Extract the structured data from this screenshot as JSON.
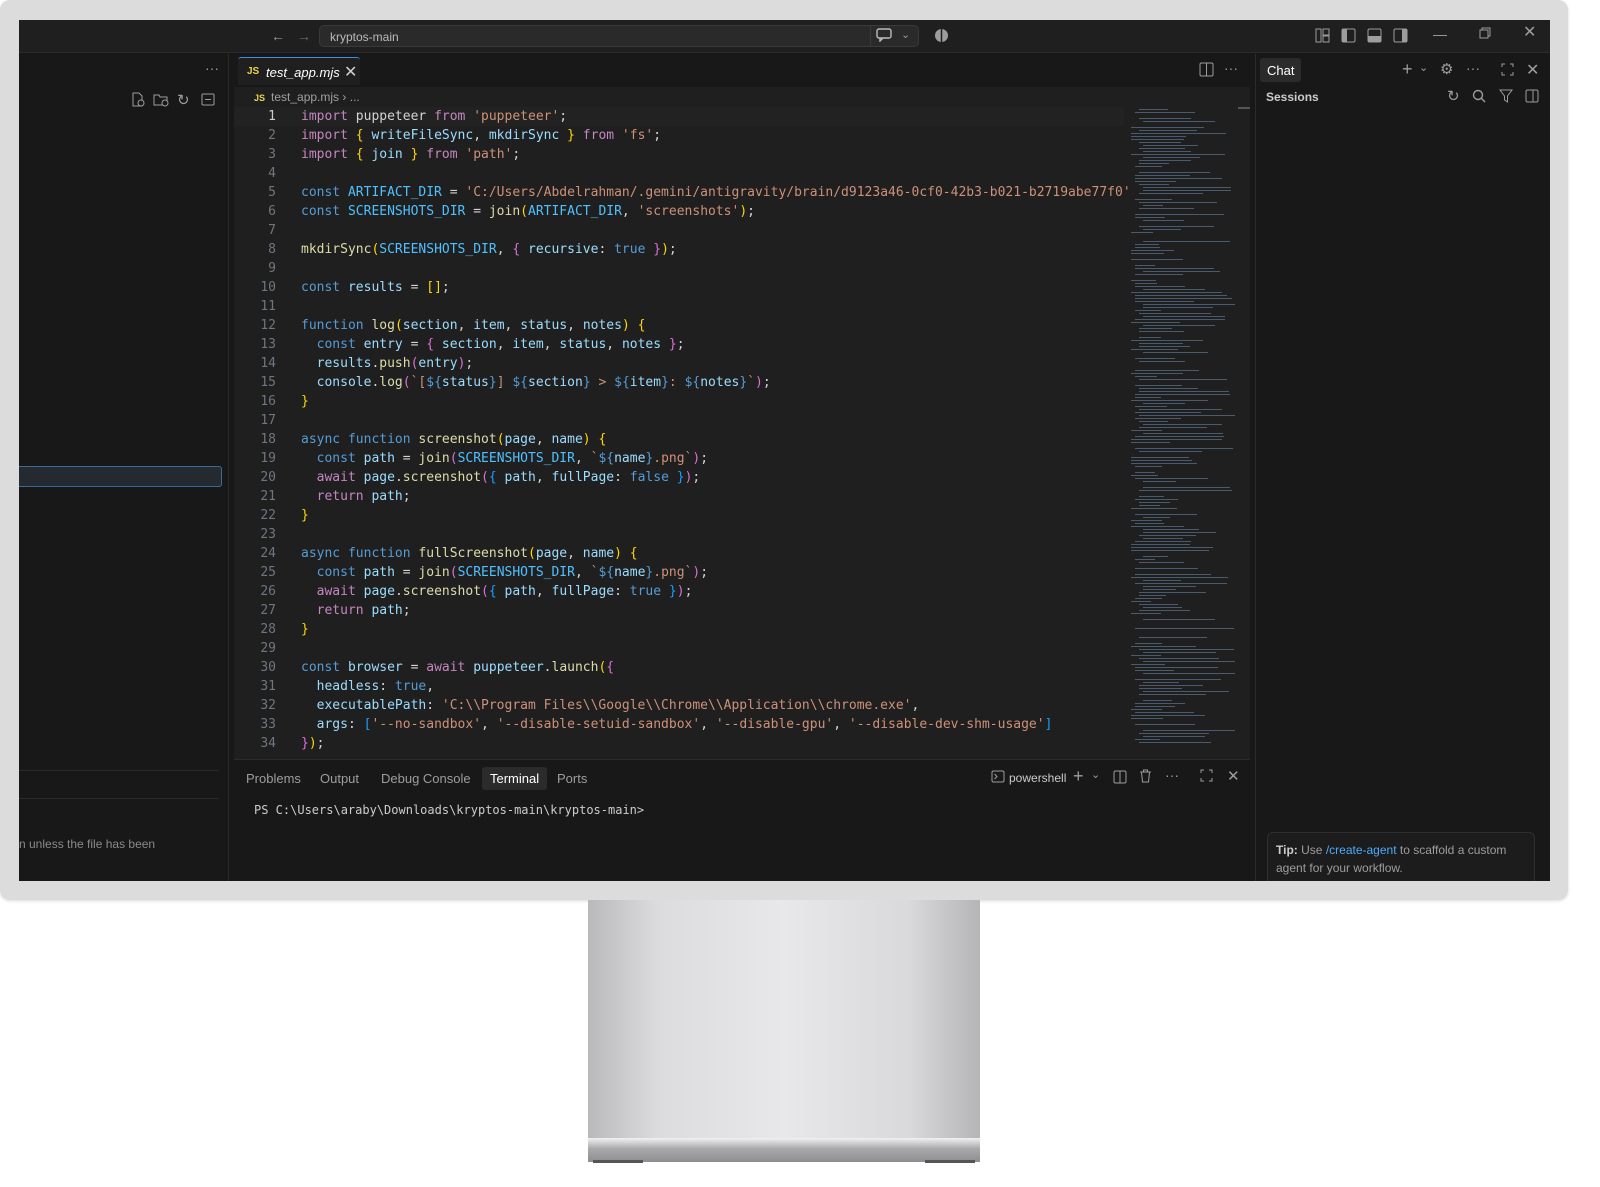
{
  "titlebar": {
    "search_label": "kryptos-main",
    "icons": [
      "back-arrow-icon",
      "forward-arrow-icon",
      "copilot-icon",
      "chevron-down-icon",
      "accounts-icon",
      "layout-icon",
      "sidebar-toggle-icon",
      "panel-toggle-icon",
      "secondary-sidebar-icon",
      "minimize-icon",
      "restore-icon",
      "close-icon"
    ]
  },
  "sidebar": {
    "more_label": "···",
    "notice": "n unless the file has been"
  },
  "editor": {
    "tab_icon": "JS",
    "tab_name": "test_app.mjs",
    "breadcrumb_icon": "JS",
    "breadcrumb": "test_app.mjs",
    "breadcrumb_more": "...",
    "lines": [
      [
        [
          "k",
          "import"
        ],
        [
          "p",
          " puppeteer "
        ],
        [
          "k",
          "from"
        ],
        [
          "s",
          " 'puppeteer'"
        ],
        [
          "p",
          ";"
        ]
      ],
      [
        [
          "k",
          "import"
        ],
        [
          "b1",
          " {"
        ],
        [
          "v",
          " writeFileSync"
        ],
        [
          "p",
          ", "
        ],
        [
          "v",
          "mkdirSync"
        ],
        [
          "b1",
          " }"
        ],
        [
          "k",
          " from"
        ],
        [
          "s",
          " 'fs'"
        ],
        [
          "p",
          ";"
        ]
      ],
      [
        [
          "k",
          "import"
        ],
        [
          "b1",
          " {"
        ],
        [
          "v",
          " join"
        ],
        [
          "b1",
          " }"
        ],
        [
          "k",
          " from"
        ],
        [
          "s",
          " 'path'"
        ],
        [
          "p",
          ";"
        ]
      ],
      [],
      [
        [
          "kw",
          "const"
        ],
        [
          "cn",
          " ARTIFACT_DIR"
        ],
        [
          "p",
          " = "
        ],
        [
          "s",
          "'C:/Users/Abdelrahman/.gemini/antigravity/brain/d9123a46-0cf0-42b3-b021-b2719abe77f0'"
        ]
      ],
      [
        [
          "kw",
          "const"
        ],
        [
          "cn",
          " SCREENSHOTS_DIR"
        ],
        [
          "p",
          " = "
        ],
        [
          "f",
          "join"
        ],
        [
          "b1",
          "("
        ],
        [
          "cn",
          "ARTIFACT_DIR"
        ],
        [
          "p",
          ", "
        ],
        [
          "s",
          "'screenshots'"
        ],
        [
          "b1",
          ")"
        ],
        [
          "p",
          ";"
        ]
      ],
      [],
      [
        [
          "f",
          "mkdirSync"
        ],
        [
          "b1",
          "("
        ],
        [
          "cn",
          "SCREENSHOTS_DIR"
        ],
        [
          "p",
          ", "
        ],
        [
          "b2",
          "{"
        ],
        [
          "v",
          " recursive"
        ],
        [
          "p",
          ": "
        ],
        [
          "kw",
          "true"
        ],
        [
          "b2",
          " }"
        ],
        [
          "b1",
          ")"
        ],
        [
          "p",
          ";"
        ]
      ],
      [],
      [
        [
          "kw",
          "const"
        ],
        [
          "v",
          " results"
        ],
        [
          "p",
          " = "
        ],
        [
          "b1",
          "[]"
        ],
        [
          "p",
          ";"
        ]
      ],
      [],
      [
        [
          "kw",
          "function"
        ],
        [
          "f",
          " log"
        ],
        [
          "b1",
          "("
        ],
        [
          "v",
          "section"
        ],
        [
          "p",
          ", "
        ],
        [
          "v",
          "item"
        ],
        [
          "p",
          ", "
        ],
        [
          "v",
          "status"
        ],
        [
          "p",
          ", "
        ],
        [
          "v",
          "notes"
        ],
        [
          "b1",
          ")"
        ],
        [
          "b1",
          " {"
        ]
      ],
      [
        [
          "p",
          "  "
        ],
        [
          "kw",
          "const"
        ],
        [
          "v",
          " entry"
        ],
        [
          "p",
          " = "
        ],
        [
          "b2",
          "{"
        ],
        [
          "v",
          " section"
        ],
        [
          "p",
          ", "
        ],
        [
          "v",
          "item"
        ],
        [
          "p",
          ", "
        ],
        [
          "v",
          "status"
        ],
        [
          "p",
          ", "
        ],
        [
          "v",
          "notes"
        ],
        [
          "b2",
          " }"
        ],
        [
          "p",
          ";"
        ]
      ],
      [
        [
          "p",
          "  "
        ],
        [
          "v",
          "results"
        ],
        [
          "p",
          "."
        ],
        [
          "f",
          "push"
        ],
        [
          "b2",
          "("
        ],
        [
          "v",
          "entry"
        ],
        [
          "b2",
          ")"
        ],
        [
          "p",
          ";"
        ]
      ],
      [
        [
          "p",
          "  "
        ],
        [
          "v",
          "console"
        ],
        [
          "p",
          "."
        ],
        [
          "f",
          "log"
        ],
        [
          "b2",
          "("
        ],
        [
          "s",
          "`["
        ],
        [
          "kw",
          "${"
        ],
        [
          "v",
          "status"
        ],
        [
          "kw",
          "}"
        ],
        [
          "s",
          "] "
        ],
        [
          "kw",
          "${"
        ],
        [
          "v",
          "section"
        ],
        [
          "kw",
          "}"
        ],
        [
          "s",
          " > "
        ],
        [
          "kw",
          "${"
        ],
        [
          "v",
          "item"
        ],
        [
          "kw",
          "}"
        ],
        [
          "s",
          ": "
        ],
        [
          "kw",
          "${"
        ],
        [
          "v",
          "notes"
        ],
        [
          "kw",
          "}"
        ],
        [
          "s",
          "`"
        ],
        [
          "b2",
          ")"
        ],
        [
          "p",
          ";"
        ]
      ],
      [
        [
          "b1",
          "}"
        ]
      ],
      [],
      [
        [
          "kw",
          "async"
        ],
        [
          "kw",
          " function"
        ],
        [
          "f",
          " screenshot"
        ],
        [
          "b1",
          "("
        ],
        [
          "v",
          "page"
        ],
        [
          "p",
          ", "
        ],
        [
          "v",
          "name"
        ],
        [
          "b1",
          ")"
        ],
        [
          "b1",
          " {"
        ]
      ],
      [
        [
          "p",
          "  "
        ],
        [
          "kw",
          "const"
        ],
        [
          "v",
          " path"
        ],
        [
          "p",
          " = "
        ],
        [
          "f",
          "join"
        ],
        [
          "b2",
          "("
        ],
        [
          "cn",
          "SCREENSHOTS_DIR"
        ],
        [
          "p",
          ", "
        ],
        [
          "s",
          "`"
        ],
        [
          "kw",
          "${"
        ],
        [
          "v",
          "name"
        ],
        [
          "kw",
          "}"
        ],
        [
          "s",
          ".png`"
        ],
        [
          "b2",
          ")"
        ],
        [
          "p",
          ";"
        ]
      ],
      [
        [
          "p",
          "  "
        ],
        [
          "k",
          "await"
        ],
        [
          "v",
          " page"
        ],
        [
          "p",
          "."
        ],
        [
          "f",
          "screenshot"
        ],
        [
          "b2",
          "("
        ],
        [
          "b3",
          "{"
        ],
        [
          "v",
          " path"
        ],
        [
          "p",
          ", "
        ],
        [
          "v",
          "fullPage"
        ],
        [
          "p",
          ": "
        ],
        [
          "kw",
          "false"
        ],
        [
          "b3",
          " }"
        ],
        [
          "b2",
          ")"
        ],
        [
          "p",
          ";"
        ]
      ],
      [
        [
          "p",
          "  "
        ],
        [
          "k",
          "return"
        ],
        [
          "v",
          " path"
        ],
        [
          "p",
          ";"
        ]
      ],
      [
        [
          "b1",
          "}"
        ]
      ],
      [],
      [
        [
          "kw",
          "async"
        ],
        [
          "kw",
          " function"
        ],
        [
          "f",
          " fullScreenshot"
        ],
        [
          "b1",
          "("
        ],
        [
          "v",
          "page"
        ],
        [
          "p",
          ", "
        ],
        [
          "v",
          "name"
        ],
        [
          "b1",
          ")"
        ],
        [
          "b1",
          " {"
        ]
      ],
      [
        [
          "p",
          "  "
        ],
        [
          "kw",
          "const"
        ],
        [
          "v",
          " path"
        ],
        [
          "p",
          " = "
        ],
        [
          "f",
          "join"
        ],
        [
          "b2",
          "("
        ],
        [
          "cn",
          "SCREENSHOTS_DIR"
        ],
        [
          "p",
          ", "
        ],
        [
          "s",
          "`"
        ],
        [
          "kw",
          "${"
        ],
        [
          "v",
          "name"
        ],
        [
          "kw",
          "}"
        ],
        [
          "s",
          ".png`"
        ],
        [
          "b2",
          ")"
        ],
        [
          "p",
          ";"
        ]
      ],
      [
        [
          "p",
          "  "
        ],
        [
          "k",
          "await"
        ],
        [
          "v",
          " page"
        ],
        [
          "p",
          "."
        ],
        [
          "f",
          "screenshot"
        ],
        [
          "b2",
          "("
        ],
        [
          "b3",
          "{"
        ],
        [
          "v",
          " path"
        ],
        [
          "p",
          ", "
        ],
        [
          "v",
          "fullPage"
        ],
        [
          "p",
          ": "
        ],
        [
          "kw",
          "true"
        ],
        [
          "b3",
          " }"
        ],
        [
          "b2",
          ")"
        ],
        [
          "p",
          ";"
        ]
      ],
      [
        [
          "p",
          "  "
        ],
        [
          "k",
          "return"
        ],
        [
          "v",
          " path"
        ],
        [
          "p",
          ";"
        ]
      ],
      [
        [
          "b1",
          "}"
        ]
      ],
      [],
      [
        [
          "kw",
          "const"
        ],
        [
          "v",
          " browser"
        ],
        [
          "p",
          " = "
        ],
        [
          "k",
          "await"
        ],
        [
          "v",
          " puppeteer"
        ],
        [
          "p",
          "."
        ],
        [
          "f",
          "launch"
        ],
        [
          "b1",
          "("
        ],
        [
          "b2",
          "{"
        ]
      ],
      [
        [
          "p",
          "  "
        ],
        [
          "v",
          "headless"
        ],
        [
          "p",
          ": "
        ],
        [
          "kw",
          "true"
        ],
        [
          "p",
          ","
        ]
      ],
      [
        [
          "p",
          "  "
        ],
        [
          "v",
          "executablePath"
        ],
        [
          "p",
          ": "
        ],
        [
          "s",
          "'C:\\\\Program Files\\\\Google\\\\Chrome\\\\Application\\\\chrome.exe'"
        ],
        [
          "p",
          ","
        ]
      ],
      [
        [
          "p",
          "  "
        ],
        [
          "v",
          "args"
        ],
        [
          "p",
          ": "
        ],
        [
          "b3",
          "["
        ],
        [
          "s",
          "'--no-sandbox'"
        ],
        [
          "p",
          ", "
        ],
        [
          "s",
          "'--disable-setuid-sandbox'"
        ],
        [
          "p",
          ", "
        ],
        [
          "s",
          "'--disable-gpu'"
        ],
        [
          "p",
          ", "
        ],
        [
          "s",
          "'--disable-dev-shm-usage'"
        ],
        [
          "b3",
          "]"
        ]
      ],
      [
        [
          "b2",
          "}"
        ],
        [
          "b1",
          ")"
        ],
        [
          "p",
          ";"
        ]
      ]
    ]
  },
  "panel": {
    "tabs": [
      "Problems",
      "Output",
      "Debug Console",
      "Terminal",
      "Ports"
    ],
    "active_tab": "Terminal",
    "shell_label": "powershell",
    "prompt": "PS C:\\Users\\araby\\Downloads\\kryptos-main\\kryptos-main>"
  },
  "chat": {
    "tab_label": "Chat",
    "sessions_label": "Sessions",
    "tip_label": "Tip:",
    "tip_pre": "Use",
    "tip_link": "/create-agent",
    "tip_post": "to scaffold a custom agent for your workflow."
  },
  "colors": {
    "accent": "#3b8eea",
    "editor_bg": "#1f1f1f",
    "panel_bg": "#181818",
    "link": "#4daafc"
  }
}
